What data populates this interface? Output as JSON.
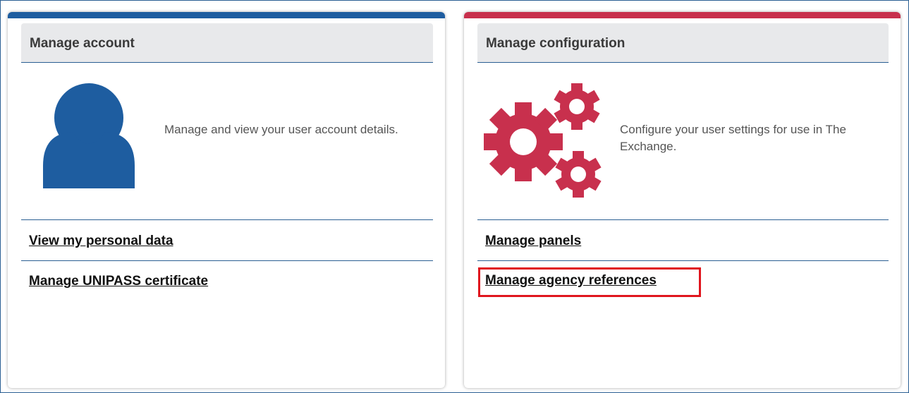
{
  "colors": {
    "account_accent": "#1e5da0",
    "config_accent": "#c8304d",
    "divider": "#2b5f93",
    "header_bg": "#e8e9eb",
    "highlight": "#e0161e"
  },
  "account": {
    "title": "Manage account",
    "icon": "user-icon",
    "description": "Manage and view your user account details.",
    "links": [
      {
        "label": "View my personal data"
      },
      {
        "label": "Manage UNIPASS certificate"
      }
    ]
  },
  "config": {
    "title": "Manage configuration",
    "icon": "gears-icon",
    "description": "Configure your user settings for use in The Exchange.",
    "links": [
      {
        "label": "Manage panels"
      },
      {
        "label": "Manage agency references",
        "highlighted": true
      }
    ]
  }
}
